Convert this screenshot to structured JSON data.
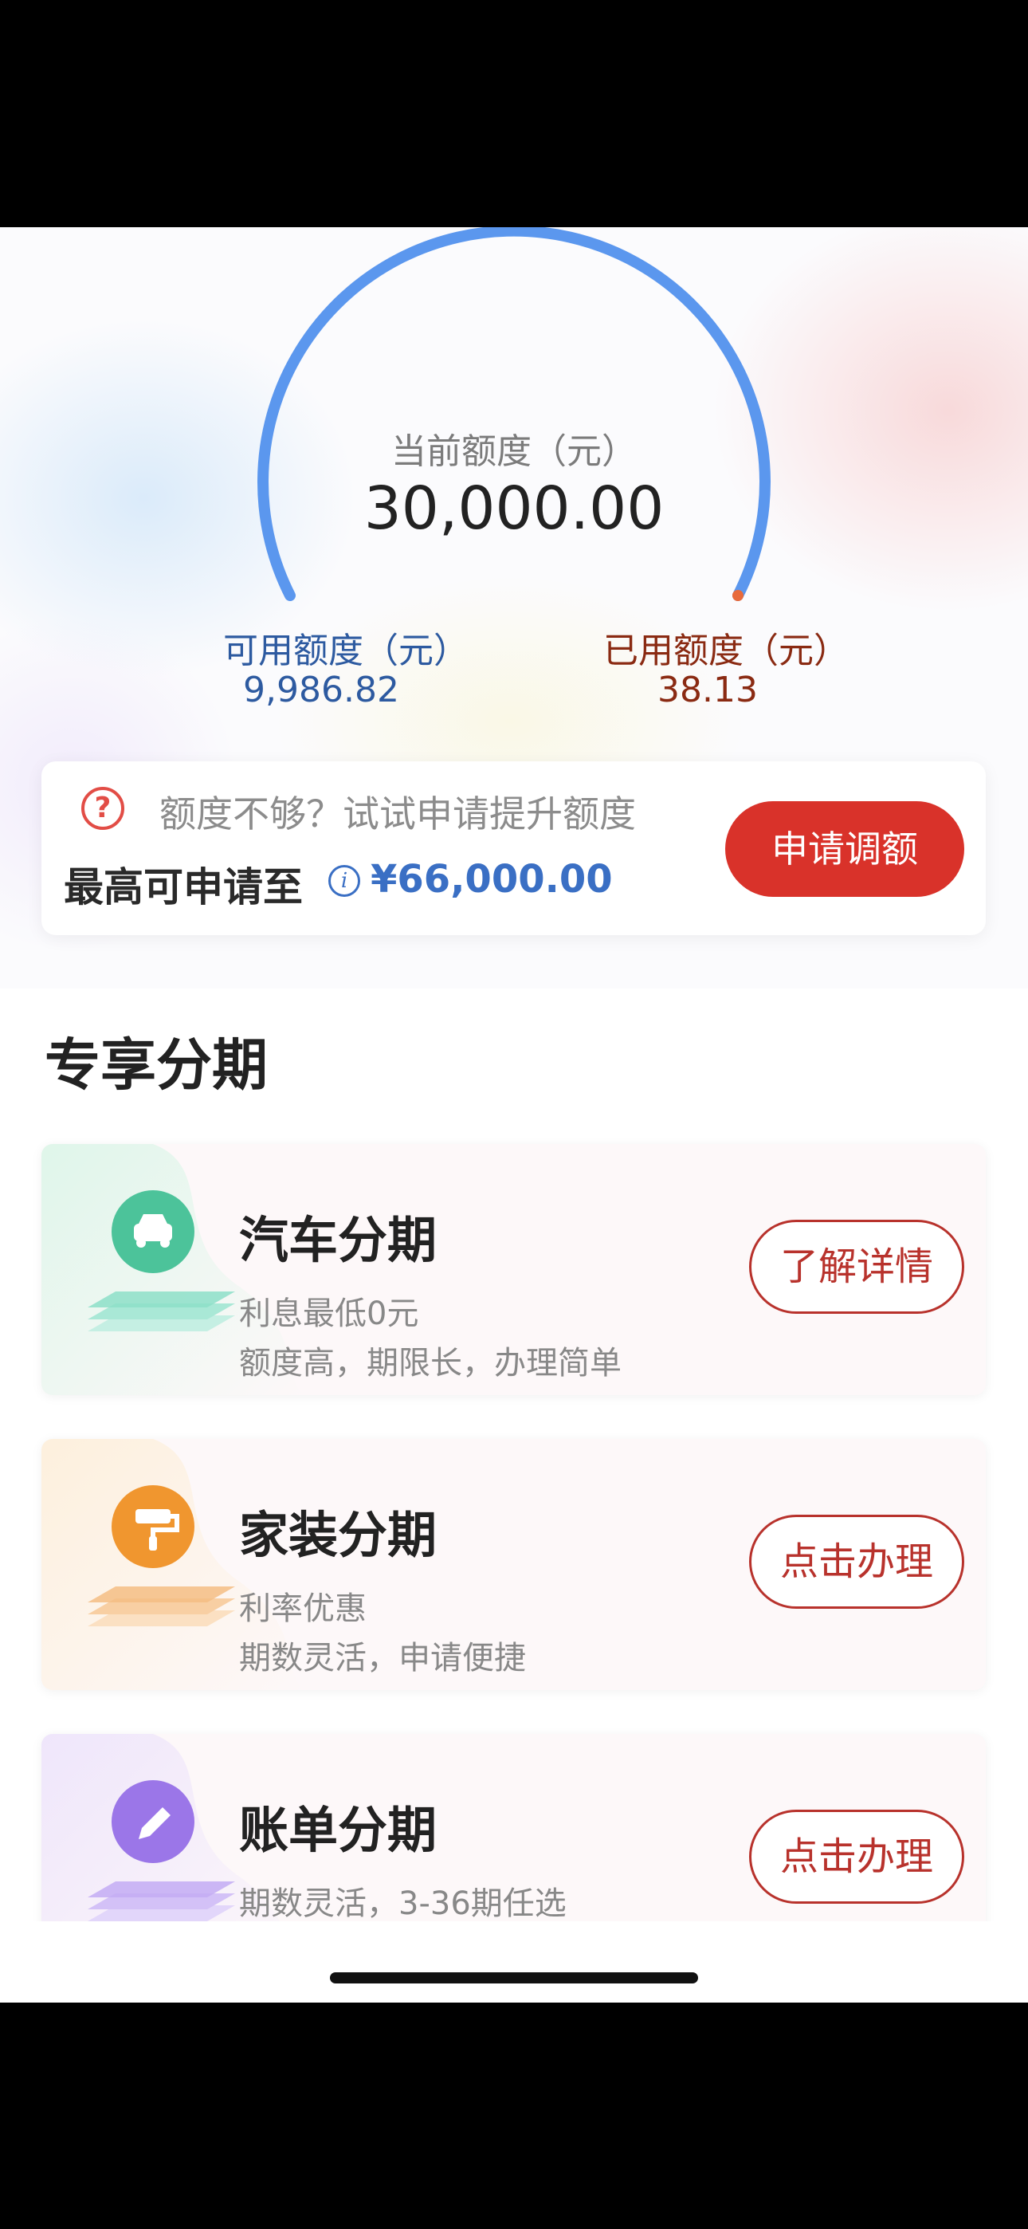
{
  "credit": {
    "current_label": "当前额度（元）",
    "current_value": "30,000.00",
    "available_label": "可用额度（元）",
    "available_value": "9,986.82",
    "used_label": "已用额度（元）",
    "used_value": "38.13",
    "available_fraction": 0.9996,
    "gauge_color": "#5b97ee"
  },
  "raise": {
    "hint": "额度不够？试试申请提升额度",
    "max_label": "最高可申请至",
    "max_value": "¥66,000.00",
    "button": "申请调额",
    "accent": "#d9322a"
  },
  "section": {
    "title": "专享分期"
  },
  "products": [
    {
      "name": "汽车分期",
      "line1": "利息最低0元",
      "line2": "额度高，期限长，办理简单",
      "button": "了解详情",
      "icon": "car-icon",
      "theme": "#4cc39a"
    },
    {
      "name": "家装分期",
      "line1": "利率优惠",
      "line2": "期数灵活，申请便捷",
      "button": "点击办理",
      "icon": "paint-roller-icon",
      "theme": "#f0962f"
    },
    {
      "name": "账单分期",
      "line1": "期数灵活，3-36期任选",
      "line2": "",
      "button": "点击办理",
      "icon": "pencil-icon",
      "theme": "#9b76e8"
    }
  ]
}
